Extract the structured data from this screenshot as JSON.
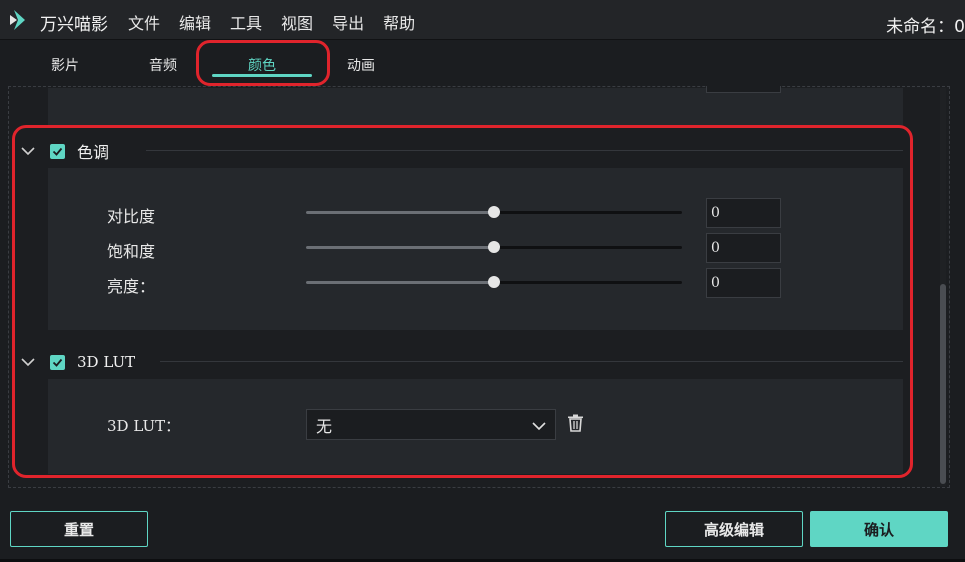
{
  "titlebar": {
    "app_name": "万兴喵影",
    "menu": [
      "文件",
      "编辑",
      "工具",
      "视图",
      "导出",
      "帮助"
    ],
    "doc_title": "未命名：0"
  },
  "tabs": [
    {
      "label": "影片",
      "active": false
    },
    {
      "label": "音频",
      "active": false
    },
    {
      "label": "颜色",
      "active": true
    },
    {
      "label": "动画",
      "active": false
    }
  ],
  "tone": {
    "title": "色调",
    "checked": true,
    "rows": [
      {
        "label": "对比度",
        "value": "0",
        "slider_fraction": 0.5
      },
      {
        "label": "饱和度",
        "value": "0",
        "slider_fraction": 0.5
      },
      {
        "label": "亮度：",
        "value": "0",
        "slider_fraction": 0.5
      }
    ]
  },
  "lut": {
    "title": "3D LUT",
    "checked": true,
    "label": "3D LUT：",
    "selected": "无"
  },
  "buttons": {
    "reset": "重置",
    "advanced": "高级编辑",
    "confirm": "确认"
  },
  "colors": {
    "accent": "#5fd6c4",
    "annotation": "#e0242c"
  }
}
